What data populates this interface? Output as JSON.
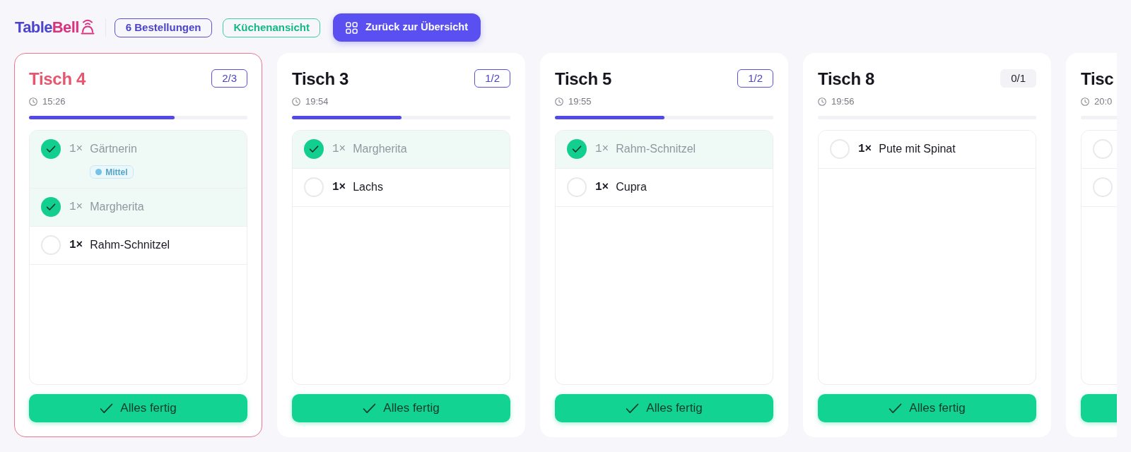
{
  "header": {
    "logo": {
      "primary": "Table",
      "accent": "Bell"
    },
    "order_count": "6 Bestellungen",
    "view_label": "Küchenansicht",
    "back_button": "Zurück zur Übersicht"
  },
  "cards": [
    {
      "title": "Tisch 4",
      "time": "15:26",
      "count": "2/3",
      "level": 0.667,
      "urgent": true,
      "items": [
        {
          "qty": "1×",
          "name": "Gärtnerin",
          "done": true,
          "tag": "Mittel"
        },
        {
          "qty": "1×",
          "name": "Margherita",
          "done": true
        },
        {
          "qty": "1×",
          "name": "Rahm-Schnitzel",
          "done": false
        }
      ],
      "action": "Alles fertig"
    },
    {
      "title": "Tisch 3",
      "time": "19:54",
      "count": "1/2",
      "level": 0.5,
      "urgent": false,
      "items": [
        {
          "qty": "1×",
          "name": "Margherita",
          "done": true
        },
        {
          "qty": "1×",
          "name": "Lachs",
          "done": false
        }
      ],
      "action": "Alles fertig"
    },
    {
      "title": "Tisch 5",
      "time": "19:55",
      "count": "1/2",
      "level": 0.5,
      "urgent": false,
      "items": [
        {
          "qty": "1×",
          "name": "Rahm-Schnitzel",
          "done": true
        },
        {
          "qty": "1×",
          "name": "Cupra",
          "done": false
        }
      ],
      "action": "Alles fertig"
    },
    {
      "title": "Tisch 8",
      "time": "19:56",
      "count": "0/1",
      "level": 0,
      "urgent": false,
      "items": [
        {
          "qty": "1×",
          "name": "Pute mit Spinat",
          "done": false
        }
      ],
      "action": "Alles fertig"
    },
    {
      "title": "Tisc",
      "time": "20:0",
      "level": 0,
      "urgent": false,
      "items": [
        {
          "done": false
        },
        {
          "done": false
        }
      ]
    }
  ]
}
